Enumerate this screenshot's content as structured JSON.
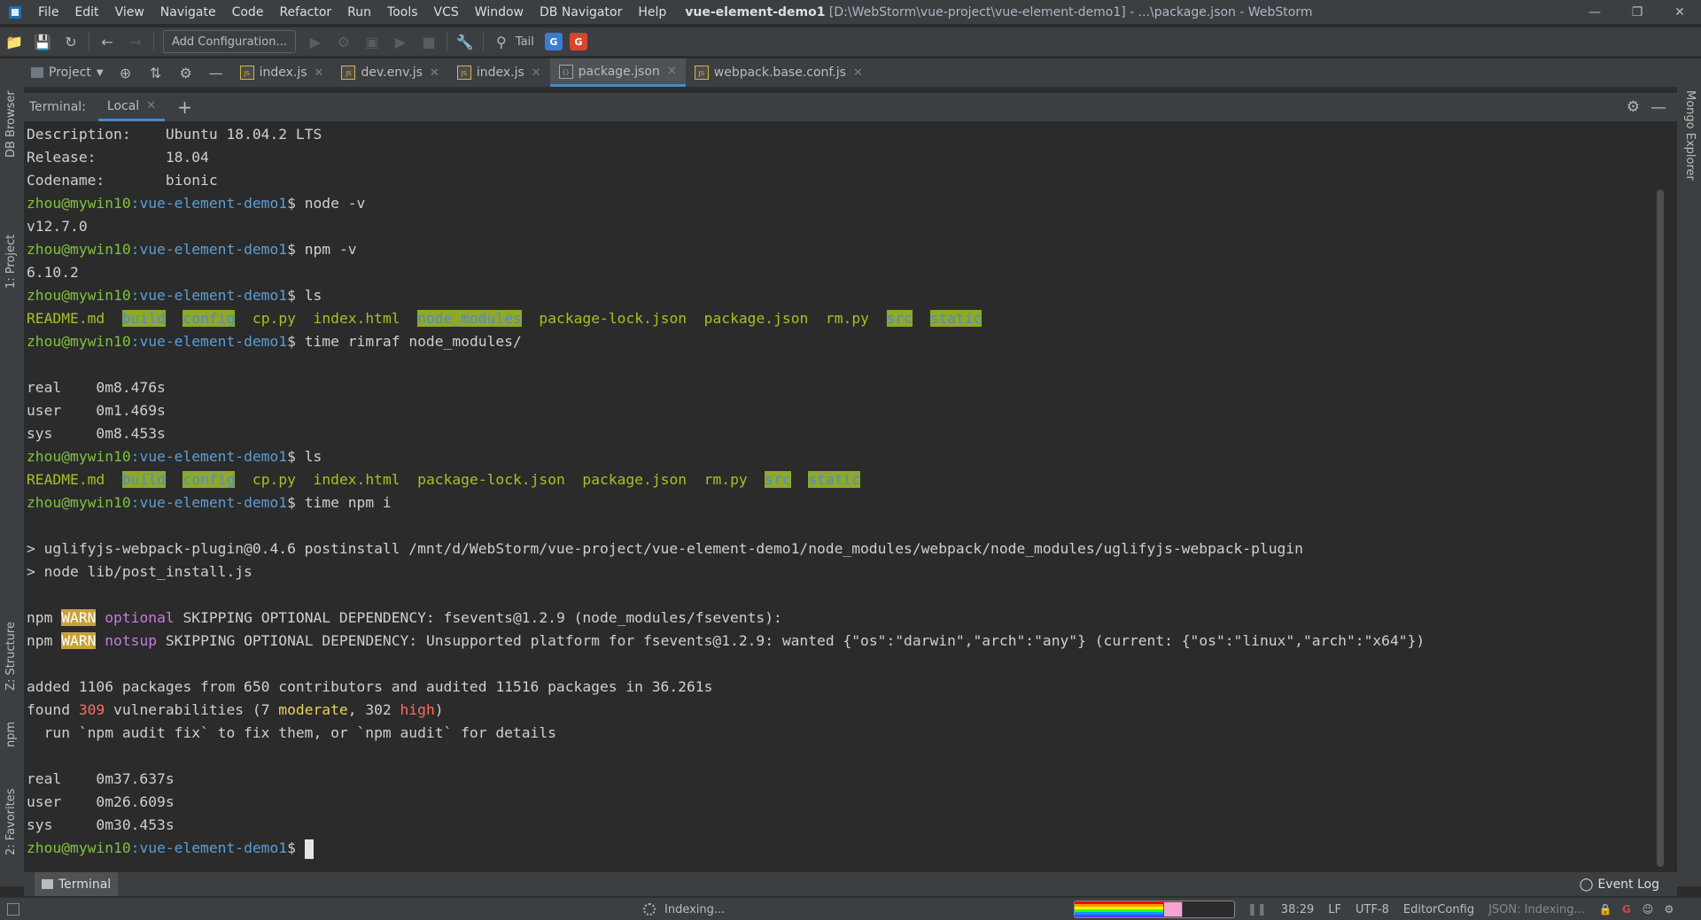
{
  "menu": {
    "items": [
      "File",
      "Edit",
      "View",
      "Navigate",
      "Code",
      "Refactor",
      "Run",
      "Tools",
      "VCS",
      "Window",
      "DB Navigator",
      "Help"
    ],
    "window_title_project": "vue-element-demo1",
    "window_title_rest": "[D:\\WebStorm\\vue-project\\vue-element-demo1] - ...\\package.json - WebStorm"
  },
  "toolbar": {
    "add_configuration": "Add Configuration...",
    "tail_label": "Tail"
  },
  "project_selector": "Project",
  "editor_tabs": [
    {
      "label": "index.js",
      "active": false
    },
    {
      "label": "dev.env.js",
      "active": false
    },
    {
      "label": "index.js",
      "active": false
    },
    {
      "label": "package.json",
      "active": true
    },
    {
      "label": "webpack.base.conf.js",
      "active": false
    }
  ],
  "left_strip": {
    "db_browser": "DB Browser",
    "project": "1: Project",
    "structure": "Z: Structure",
    "npm": "npm",
    "favorites": "2: Favorites"
  },
  "right_strip": {
    "mongo_explorer": "Mongo Explorer"
  },
  "terminal": {
    "title": "Terminal:",
    "tab": "Local",
    "prompt_user": "zhou@mywin10",
    "prompt_path": ":vue-element-demo1",
    "prompt_sign": "$ ",
    "lines": {
      "desc": "Description:    Ubuntu 18.04.2 LTS",
      "release": "Release:        18.04",
      "codename": "Codename:       bionic",
      "cmd_node": "node -v",
      "out_node": "v12.7.0",
      "cmd_npm": "npm -v",
      "out_npm": "6.10.2",
      "cmd_ls1": "ls",
      "ls1": [
        "README.md",
        "build",
        "config",
        "cp.py",
        "index.html",
        "node_modules",
        "package-lock.json",
        "package.json",
        "rm.py",
        "src",
        "static"
      ],
      "cmd_rimraf": "time rimraf node_modules/",
      "real1": "real    0m8.476s",
      "user1": "user    0m1.469s",
      "sys1": "sys     0m8.453s",
      "cmd_ls2": "ls",
      "ls2": [
        "README.md",
        "build",
        "config",
        "cp.py",
        "index.html",
        "package-lock.json",
        "package.json",
        "rm.py",
        "src",
        "static"
      ],
      "cmd_npmi": "time npm i",
      "postinstall1": "> uglifyjs-webpack-plugin@0.4.6 postinstall /mnt/d/WebStorm/vue-project/vue-element-demo1/node_modules/webpack/node_modules/uglifyjs-webpack-plugin",
      "postinstall2": "> node lib/post_install.js",
      "warn1_pre": "npm ",
      "warn_tag": "WARN",
      "warn1_kind": "optional",
      "warn1_msg": " SKIPPING OPTIONAL DEPENDENCY: fsevents@1.2.9 (node_modules/fsevents):",
      "warn2_kind": "notsup",
      "warn2_msg": " SKIPPING OPTIONAL DEPENDENCY: Unsupported platform for fsevents@1.2.9: wanted {\"os\":\"darwin\",\"arch\":\"any\"} (current: {\"os\":\"linux\",\"arch\":\"x64\"})",
      "added": "added 1106 packages from 650 contributors and audited 11516 packages in 36.261s",
      "found_pre": "found ",
      "found_num": "309",
      "found_mid": " vulnerabilities (7 ",
      "found_moderate": "moderate",
      "found_comma": ", 302 ",
      "found_high": "high",
      "found_end": ")",
      "run_fix": "  run `npm audit fix` to fix them, or `npm audit` for details",
      "real2": "real    0m37.637s",
      "user2": "user    0m26.609s",
      "sys2": "sys     0m30.453s"
    }
  },
  "bottom": {
    "terminal_tab": "Terminal",
    "event_log": "Event Log"
  },
  "status": {
    "indexing": "Indexing...",
    "progress_fraction": 0.58,
    "position": "38:29",
    "line_sep": "LF",
    "encoding": "UTF-8",
    "editor_config": "EditorConfig",
    "json_indexing": "JSON: Indexing..."
  },
  "colors": {
    "prompt_user": "#7ec23c",
    "prompt_path": "#5a9ed6",
    "dir_bg": "#8fa82a",
    "warn_bg": "#c8a13a",
    "accent": "#4a88c7"
  }
}
